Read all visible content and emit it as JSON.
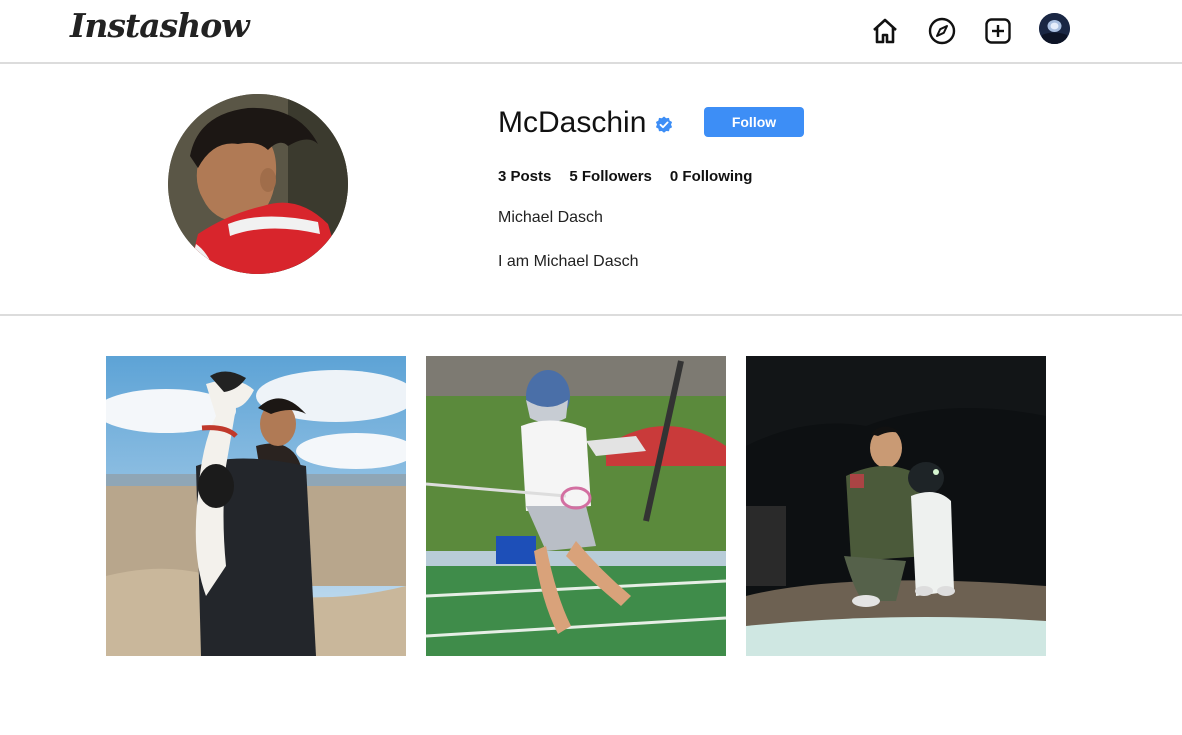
{
  "app": {
    "logo": "Instashow"
  },
  "nav": {
    "icons": [
      "home-icon",
      "compass-icon",
      "plus-square-icon",
      "avatar"
    ]
  },
  "profile": {
    "username": "McDaschin",
    "verified": true,
    "follow_label": "Follow",
    "stats": {
      "posts": "3 Posts",
      "followers": "5 Followers",
      "following": "0 Following"
    },
    "full_name": "Michael Dasch",
    "bio": "I am Michael Dasch"
  },
  "posts": [
    {
      "subject": "person holding dog on cliff"
    },
    {
      "subject": "lacrosse player running"
    },
    {
      "subject": "person crouching with dog at night"
    }
  ],
  "colors": {
    "accent": "#3d8ef6",
    "divider": "#dcdcdc"
  }
}
